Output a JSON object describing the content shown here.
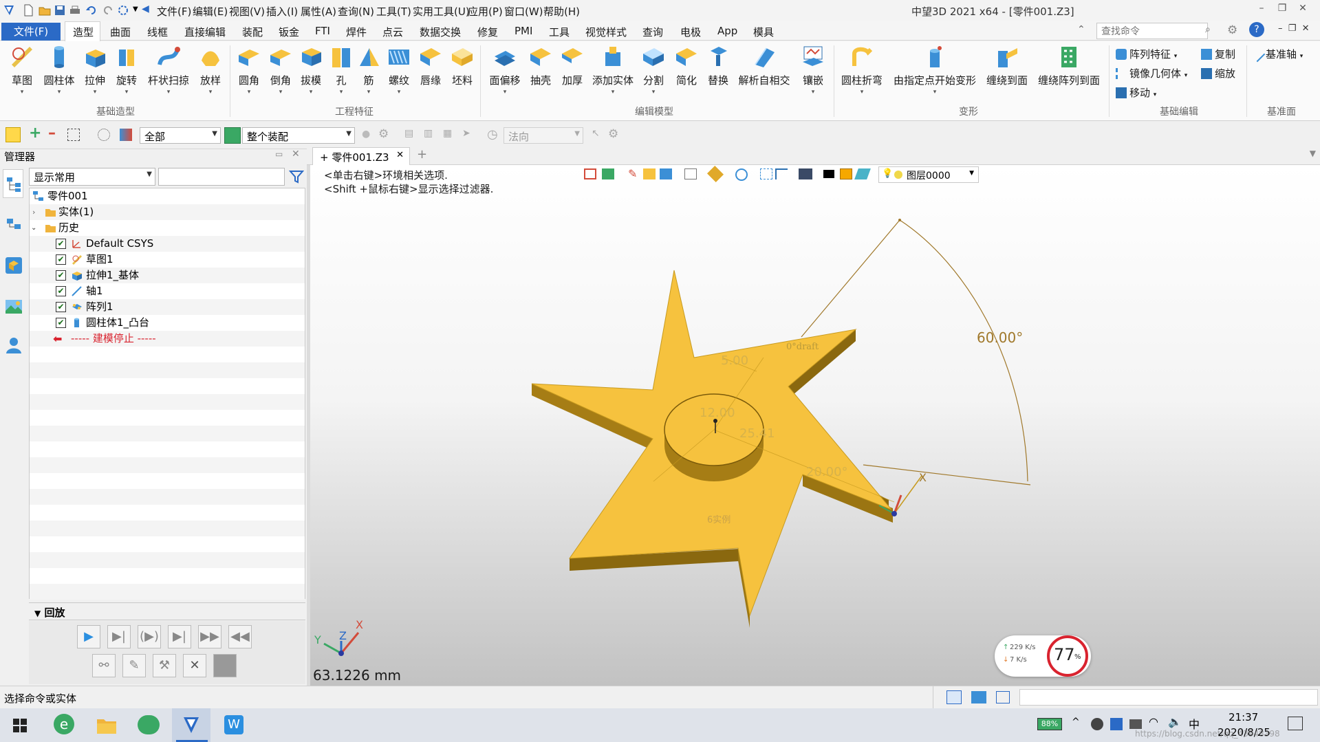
{
  "window": {
    "title": "中望3D 2021 x64 - [零件001.Z3]",
    "menu": [
      "文件(F)",
      "编辑(E)",
      "视图(V)",
      "插入(I)",
      "属性(A)",
      "查询(N)",
      "工具(T)",
      "实用工具(U)",
      "应用(P)",
      "窗口(W)",
      "帮助(H)"
    ]
  },
  "ribbon": {
    "file_tab": "文件(F)",
    "tabs": [
      "造型",
      "曲面",
      "线框",
      "直接编辑",
      "装配",
      "钣金",
      "FTI",
      "焊件",
      "点云",
      "数据交换",
      "修复",
      "PMI",
      "工具",
      "视觉样式",
      "查询",
      "电极",
      "App",
      "模具"
    ],
    "search_placeholder": "查找命令",
    "groups": {
      "basic": "基础造型",
      "eng": "工程特征",
      "edit": "编辑模型",
      "deform": "变形",
      "basic_edit": "基础编辑",
      "datum": "基准面"
    },
    "buttons": {
      "sketch": "草图",
      "cylinder": "圆柱体",
      "extrude": "拉伸",
      "revolve": "旋转",
      "sweep": "杆状扫掠",
      "loft": "放样",
      "fillet": "圆角",
      "chamfer": "倒角",
      "draft": "拔模",
      "hole": "孔",
      "rib": "筋",
      "thread": "螺纹",
      "lip": "唇缘",
      "blank": "坯料",
      "offset": "面偏移",
      "shell": "抽壳",
      "thicken": "加厚",
      "add_solid": "添加实体",
      "split": "分割",
      "simplify": "简化",
      "replace": "替换",
      "self_intersect": "解析自相交",
      "inlay": "镶嵌",
      "cyl_bend": "圆柱折弯",
      "point_deform": "由指定点开始变形",
      "wrap": "缠绕到面",
      "wrap_pattern": "缠绕阵列到面",
      "pattern": "阵列特征",
      "mirror": "镜像几何体",
      "move": "移动",
      "copy": "复制",
      "scale": "缩放",
      "datum_axis": "基准轴"
    }
  },
  "toolbar2": {
    "filter_all": "全部",
    "assembly": "整个装配",
    "direction": "法向"
  },
  "manager": {
    "title": "管理器",
    "display_filter": "显示常用",
    "tree": {
      "root": "零件001",
      "solids": "实体(1)",
      "history": "历史",
      "items": [
        "Default CSYS",
        "草图1",
        "拉伸1_基体",
        "轴1",
        "阵列1",
        "圆柱体1_凸台"
      ],
      "stop": "----- 建模停止 -----"
    },
    "replay_title": "回放"
  },
  "document": {
    "tab_label": "零件001.Z3",
    "hint1": "<单击右键>环境相关选项.",
    "hint2": "<Shift +鼠标右键>显示选择过滤器.",
    "layer": "图层0000",
    "measure": "63.1226 mm",
    "annotations": {
      "angle": "60.00°",
      "draft": "0°draft",
      "dim1": "5.00",
      "dim2": "12.00",
      "dim3": "25.41",
      "dim4": "20.00°",
      "instances": "6实例"
    },
    "axes": {
      "x": "X",
      "y": "Y",
      "z": "Z"
    }
  },
  "network": {
    "up": "229 K/s",
    "down": "7  K/s",
    "percent": "77",
    "percent_unit": "%"
  },
  "status": {
    "text": "选择命令或实体"
  },
  "taskbar": {
    "battery": "88%",
    "time": "21:37",
    "date": "2020/8/25",
    "watermark": "https://blog.csdn.net/qq_43948398"
  },
  "colors": {
    "part": "#f6c23e",
    "part_side": "#a67d15",
    "accent": "#2b6ac6",
    "dim": "#a0782a"
  }
}
